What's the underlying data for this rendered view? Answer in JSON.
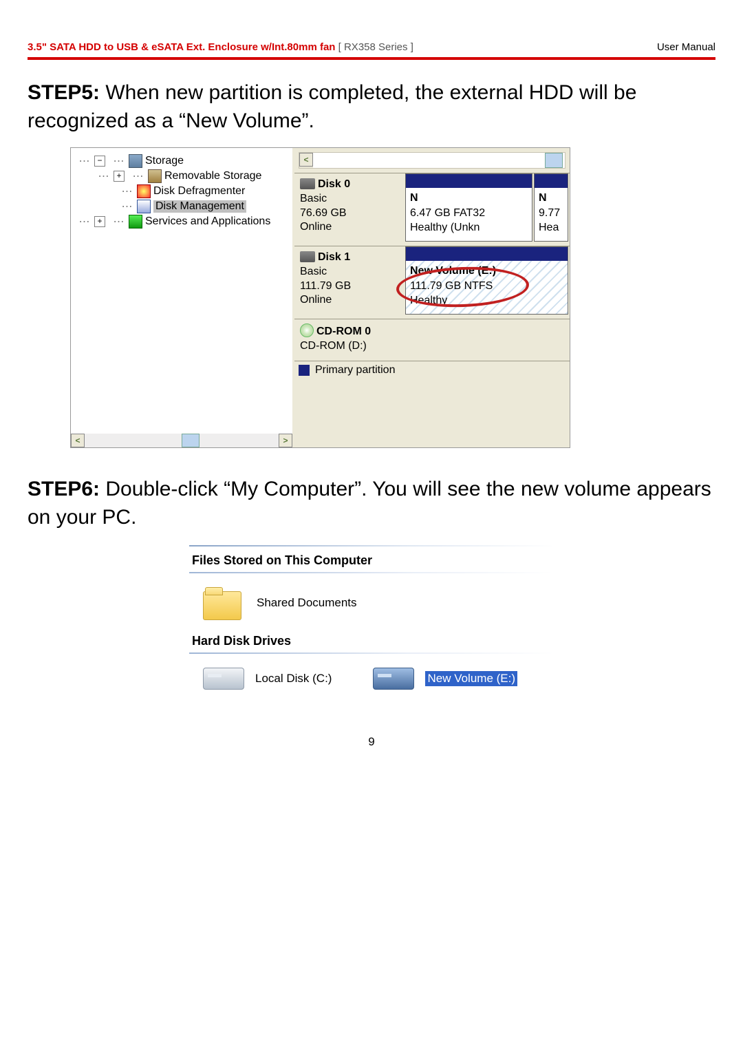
{
  "header": {
    "title": "3.5\" SATA HDD to USB & eSATA Ext. Enclosure w/Int.80mm fan",
    "series": "[ RX358 Series ]",
    "right": "User Manual"
  },
  "steps": {
    "s5_label": "STEP5:",
    "s5_text": " When new partition is completed, the external HDD will be recognized as a “New Volume”.",
    "s6_label": "STEP6:",
    "s6_text": " Double-click “My Computer”.    You will see the new volume appears on your PC."
  },
  "tree": {
    "n0": "Storage",
    "n1": "Removable Storage",
    "n2": "Disk Defragmenter",
    "n3": "Disk Management",
    "n4": "Services and Applications"
  },
  "disks": {
    "d0": {
      "title": "Disk 0",
      "l1": "Basic",
      "l2": "76.69 GB",
      "l3": "Online"
    },
    "d0p1": {
      "a": "N",
      "b": "6.47 GB FAT32",
      "c": "Healthy (Unkn"
    },
    "d0p2": {
      "a": "N",
      "b": "9.77",
      "c": "Hea"
    },
    "d1": {
      "title": "Disk 1",
      "l1": "Basic",
      "l2": "111.79 GB",
      "l3": "Online"
    },
    "d1p1": {
      "a": "New Volume  (E:)",
      "b": "111.79 GB NTFS",
      "c": "Healthy"
    },
    "cd": {
      "title": "CD-ROM 0",
      "l1": "CD-ROM (D:)"
    },
    "legend": "Primary partition"
  },
  "mycomputer": {
    "sec1": "Files Stored on This Computer",
    "shared": "Shared Documents",
    "sec2": "Hard Disk Drives",
    "local": "Local Disk (C:)",
    "newvol": "New Volume (E:)"
  },
  "page_number": "9"
}
